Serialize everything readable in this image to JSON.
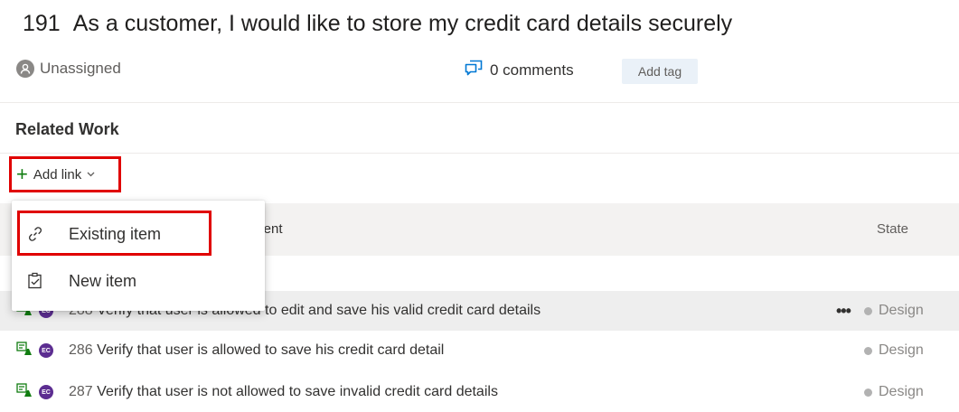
{
  "work_item": {
    "id": "191",
    "title": "As a customer, I would like to store my credit card details securely",
    "assignee": "Unassigned",
    "comments": "0 comments",
    "add_tag": "Add tag"
  },
  "related_work": {
    "heading": "Related Work",
    "add_link_label": "Add link",
    "columns": {
      "parent": "parent",
      "state": "State"
    },
    "menu": [
      {
        "label": "Existing item",
        "icon": "link-icon"
      },
      {
        "label": "New item",
        "icon": "new-item-icon"
      }
    ],
    "rows": [
      {
        "id": "288",
        "owner": "EC",
        "title": "Verify that user is allowed to edit and save his valid credit card details",
        "state": "Design",
        "more": "•••"
      },
      {
        "id": "286",
        "owner": "EC",
        "title": "Verify that user is allowed to save his credit card detail",
        "state": "Design"
      },
      {
        "id": "287",
        "owner": "EC",
        "title": "Verify that user is not allowed to save invalid credit card details",
        "state": "Design"
      }
    ]
  },
  "colors": {
    "accent": "#0078d4",
    "highlight": "#e00000",
    "add": "#107c10",
    "owner": "#5c2d91"
  }
}
